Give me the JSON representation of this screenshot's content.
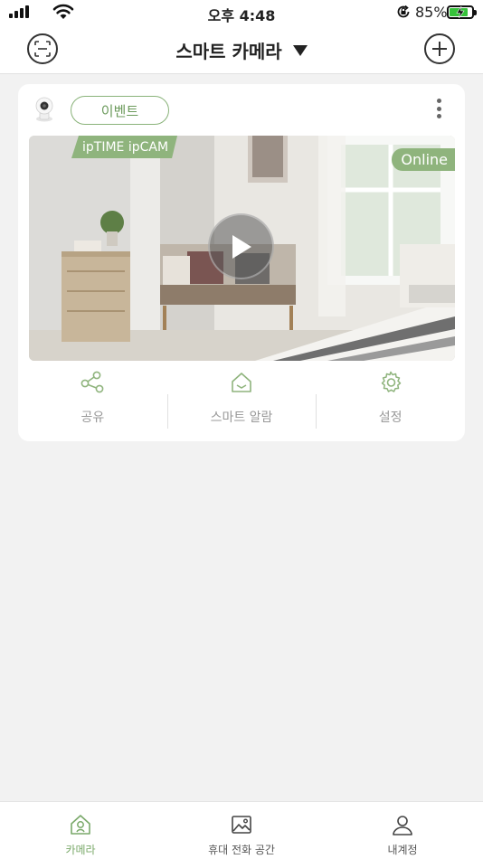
{
  "status_bar": {
    "time": "오후 4:48",
    "battery": "85%",
    "battery_level": 0.85
  },
  "header": {
    "title": "스마트 카메라"
  },
  "camera_card": {
    "event_label": "이벤트",
    "brand_tag": "ipTIME ipCAM",
    "status": "Online",
    "actions": [
      {
        "label": "공유",
        "icon": "share-icon"
      },
      {
        "label": "스마트 알람",
        "icon": "home-alarm-icon"
      },
      {
        "label": "설정",
        "icon": "gear-icon"
      }
    ]
  },
  "tabbar": {
    "tabs": [
      {
        "label": "카메라",
        "icon": "home-camera-icon",
        "active": true
      },
      {
        "label": "휴대 전화 공간",
        "icon": "image-icon",
        "active": false
      },
      {
        "label": "내계정",
        "icon": "person-icon",
        "active": false
      }
    ]
  },
  "colors": {
    "accent": "#8fb47d",
    "accent_text": "#6b9a5b"
  }
}
